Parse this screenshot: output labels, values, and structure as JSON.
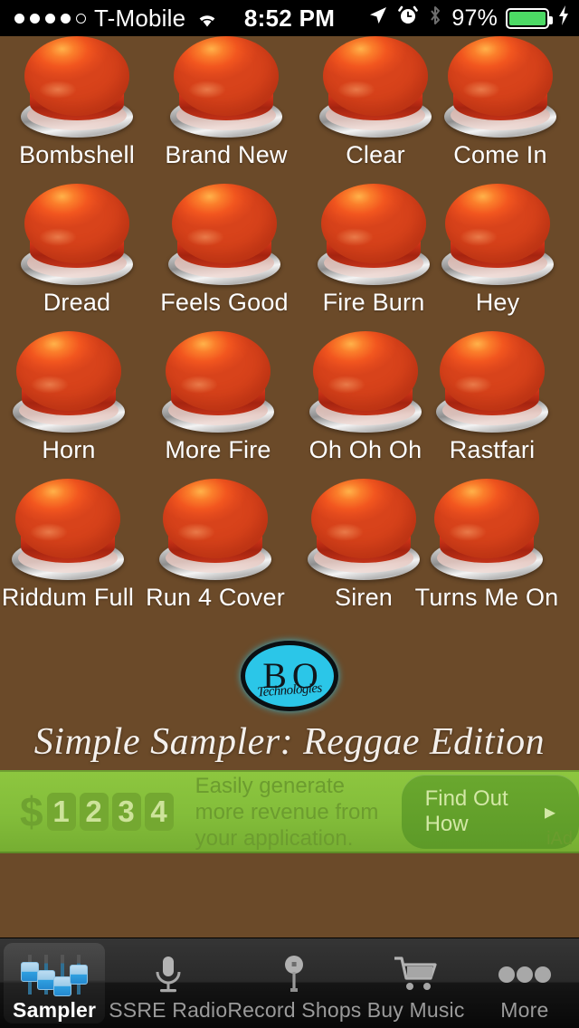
{
  "status_bar": {
    "signal_dots_filled": 4,
    "signal_dots_total": 5,
    "carrier": "T-Mobile",
    "wifi_icon": "wifi-icon",
    "time": "8:52 PM",
    "location_icon": "location-arrow-icon",
    "alarm_icon": "alarm-clock-icon",
    "bluetooth_icon": "bluetooth-icon",
    "battery_percent": "97%",
    "charging_icon": "lightning-bolt-icon"
  },
  "grid": {
    "rows": [
      [
        {
          "label": "Bombshell"
        },
        {
          "label": "Brand New"
        },
        {
          "label": "Clear"
        },
        {
          "label": "Come In"
        }
      ],
      [
        {
          "label": "Dread"
        },
        {
          "label": "Feels Good"
        },
        {
          "label": "Fire Burn"
        },
        {
          "label": "Hey"
        }
      ],
      [
        {
          "label": "Horn"
        },
        {
          "label": "More Fire"
        },
        {
          "label": "Oh Oh Oh"
        },
        {
          "label": "Rastfari"
        }
      ],
      [
        {
          "label": "Riddum Full"
        },
        {
          "label": "Run 4 Cover"
        },
        {
          "label": "Siren"
        },
        {
          "label": "Turns Me On"
        }
      ]
    ]
  },
  "logo": {
    "letters": "B O",
    "subtitle": "Technologies"
  },
  "app_title": "Simple Sampler: Reggae Edition",
  "ad": {
    "dollar": "$",
    "digits": [
      "1",
      "2",
      "3",
      "4"
    ],
    "copy": "Easily generate more revenue from your application.",
    "cta_label": "Find Out How",
    "cta_chevron": "▸",
    "badge": "iAd"
  },
  "tabbar": {
    "tabs": [
      {
        "label": "Sampler",
        "icon": "faders-icon",
        "active": true
      },
      {
        "label": "SSRE Radio",
        "icon": "microphone-icon",
        "active": false
      },
      {
        "label": "Record Shops",
        "icon": "map-pin-icon",
        "active": false
      },
      {
        "label": "Buy Music",
        "icon": "shopping-cart-icon",
        "active": false
      },
      {
        "label": "More",
        "icon": "ellipsis-icon",
        "active": false
      }
    ]
  },
  "colors": {
    "background": "#6B4A29",
    "button_orange": "#F2561F",
    "ad_green": "#8DC63F",
    "battery_green": "#4CD964",
    "logo_cyan": "#2BC6E8"
  }
}
